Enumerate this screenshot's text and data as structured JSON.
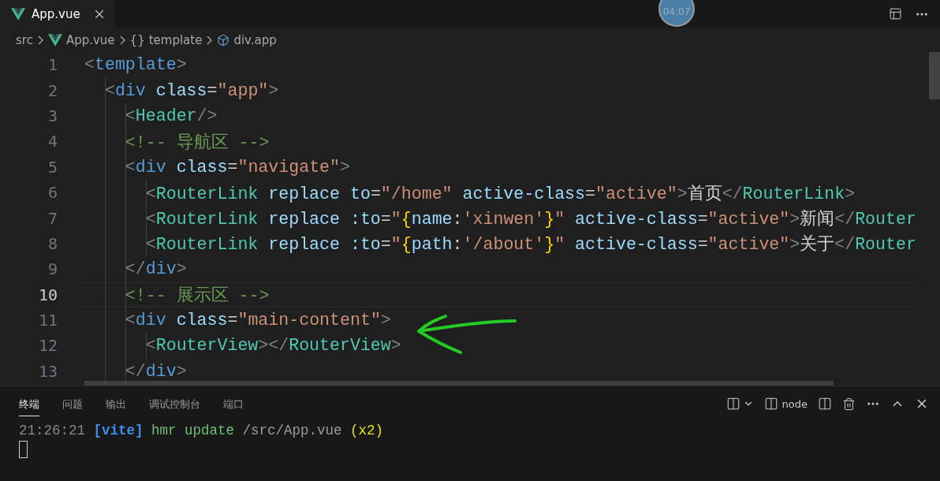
{
  "tabs": [
    {
      "label": "App.vue",
      "selected": true
    }
  ],
  "timer": "04:07",
  "breadcrumb": [
    {
      "kind": "text",
      "label": "src"
    },
    {
      "kind": "vue",
      "label": "App.vue"
    },
    {
      "kind": "braces",
      "icon": "{}",
      "label": "template"
    },
    {
      "kind": "element",
      "label": "div.app"
    }
  ],
  "code_lines": [
    {
      "number": "1",
      "current": false,
      "tokens": [
        {
          "kind": "punct",
          "text": "<"
        },
        {
          "kind": "tag",
          "text": "template"
        },
        {
          "kind": "punct",
          "text": ">"
        }
      ]
    },
    {
      "number": "2",
      "current": false,
      "tokens": [
        {
          "kind": "punct",
          "text": "  <"
        },
        {
          "kind": "tag",
          "text": "div"
        },
        {
          "kind": "attr",
          "text": " class"
        },
        {
          "kind": "plain",
          "text": "="
        },
        {
          "kind": "string",
          "text": "\"app\""
        },
        {
          "kind": "punct",
          "text": ">"
        }
      ]
    },
    {
      "number": "3",
      "current": false,
      "tokens": [
        {
          "kind": "punct",
          "text": "    <"
        },
        {
          "kind": "component",
          "text": "Header"
        },
        {
          "kind": "punct",
          "text": "/>"
        }
      ]
    },
    {
      "number": "4",
      "current": false,
      "tokens": [
        {
          "kind": "comment",
          "text": "    <!-- 导航区 -->"
        }
      ]
    },
    {
      "number": "5",
      "current": false,
      "tokens": [
        {
          "kind": "punct",
          "text": "    <"
        },
        {
          "kind": "tag",
          "text": "div"
        },
        {
          "kind": "attr",
          "text": " class"
        },
        {
          "kind": "plain",
          "text": "="
        },
        {
          "kind": "string",
          "text": "\"navigate\""
        },
        {
          "kind": "punct",
          "text": ">"
        }
      ]
    },
    {
      "number": "6",
      "current": false,
      "tokens": [
        {
          "kind": "punct",
          "text": "      <"
        },
        {
          "kind": "component",
          "text": "RouterLink"
        },
        {
          "kind": "attr",
          "text": " replace"
        },
        {
          "kind": "attr",
          "text": " to"
        },
        {
          "kind": "plain",
          "text": "="
        },
        {
          "kind": "string",
          "text": "\"/home\""
        },
        {
          "kind": "attr",
          "text": " active-class"
        },
        {
          "kind": "plain",
          "text": "="
        },
        {
          "kind": "string",
          "text": "\"active\""
        },
        {
          "kind": "punct",
          "text": ">"
        },
        {
          "kind": "plain",
          "text": "首页"
        },
        {
          "kind": "punct",
          "text": "</"
        },
        {
          "kind": "component",
          "text": "RouterLink"
        },
        {
          "kind": "punct",
          "text": ">"
        }
      ]
    },
    {
      "number": "7",
      "current": false,
      "tokens": [
        {
          "kind": "punct",
          "text": "      <"
        },
        {
          "kind": "component",
          "text": "RouterLink"
        },
        {
          "kind": "attr",
          "text": " replace"
        },
        {
          "kind": "attr",
          "text": " :to"
        },
        {
          "kind": "plain",
          "text": "="
        },
        {
          "kind": "string",
          "text": "\""
        },
        {
          "kind": "brace",
          "text": "{"
        },
        {
          "kind": "attr",
          "text": "name"
        },
        {
          "kind": "plain",
          "text": ":"
        },
        {
          "kind": "string",
          "text": "'xinwen'"
        },
        {
          "kind": "brace",
          "text": "}"
        },
        {
          "kind": "string",
          "text": "\""
        },
        {
          "kind": "attr",
          "text": " active-class"
        },
        {
          "kind": "plain",
          "text": "="
        },
        {
          "kind": "string",
          "text": "\"active\""
        },
        {
          "kind": "punct",
          "text": ">"
        },
        {
          "kind": "plain",
          "text": "新闻"
        },
        {
          "kind": "punct",
          "text": "</"
        },
        {
          "kind": "component",
          "text": "Router"
        }
      ]
    },
    {
      "number": "8",
      "current": false,
      "tokens": [
        {
          "kind": "punct",
          "text": "      <"
        },
        {
          "kind": "component",
          "text": "RouterLink"
        },
        {
          "kind": "attr",
          "text": " replace"
        },
        {
          "kind": "attr",
          "text": " :to"
        },
        {
          "kind": "plain",
          "text": "="
        },
        {
          "kind": "string",
          "text": "\""
        },
        {
          "kind": "brace",
          "text": "{"
        },
        {
          "kind": "attr",
          "text": "path"
        },
        {
          "kind": "plain",
          "text": ":"
        },
        {
          "kind": "string",
          "text": "'/about'"
        },
        {
          "kind": "brace",
          "text": "}"
        },
        {
          "kind": "string",
          "text": "\""
        },
        {
          "kind": "attr",
          "text": " active-class"
        },
        {
          "kind": "plain",
          "text": "="
        },
        {
          "kind": "string",
          "text": "\"active\""
        },
        {
          "kind": "punct",
          "text": ">"
        },
        {
          "kind": "plain",
          "text": "关于"
        },
        {
          "kind": "punct",
          "text": "</"
        },
        {
          "kind": "component",
          "text": "Router"
        }
      ]
    },
    {
      "number": "9",
      "current": false,
      "tokens": [
        {
          "kind": "punct",
          "text": "    </"
        },
        {
          "kind": "tag",
          "text": "div"
        },
        {
          "kind": "punct",
          "text": ">"
        }
      ]
    },
    {
      "number": "10",
      "current": true,
      "tokens": [
        {
          "kind": "comment",
          "text": "    <!-- 展示区 -->"
        }
      ]
    },
    {
      "number": "11",
      "current": false,
      "tokens": [
        {
          "kind": "punct",
          "text": "    <"
        },
        {
          "kind": "tag",
          "text": "div"
        },
        {
          "kind": "attr",
          "text": " class"
        },
        {
          "kind": "plain",
          "text": "="
        },
        {
          "kind": "string",
          "text": "\"main-content\""
        },
        {
          "kind": "punct",
          "text": ">"
        }
      ]
    },
    {
      "number": "12",
      "current": false,
      "tokens": [
        {
          "kind": "punct",
          "text": "      <"
        },
        {
          "kind": "component",
          "text": "RouterView"
        },
        {
          "kind": "punct",
          "text": "></"
        },
        {
          "kind": "component",
          "text": "RouterView"
        },
        {
          "kind": "punct",
          "text": ">"
        }
      ]
    },
    {
      "number": "13",
      "current": false,
      "tokens": [
        {
          "kind": "punct",
          "text": "    </"
        },
        {
          "kind": "tag",
          "text": "div"
        },
        {
          "kind": "punct",
          "text": ">"
        }
      ]
    }
  ],
  "panel_tabs": [
    {
      "label": "终端",
      "selected": true
    },
    {
      "label": "问题",
      "selected": false
    },
    {
      "label": "输出",
      "selected": false
    },
    {
      "label": "调试控制台",
      "selected": false
    },
    {
      "label": "端口",
      "selected": false
    }
  ],
  "terminal_name": "node",
  "terminal_lines": [
    {
      "tokens": [
        {
          "kind": "time",
          "text": "21:26:21"
        },
        {
          "kind": "tag",
          "text": " [vite]"
        },
        {
          "kind": "action",
          "text": " hmr update"
        },
        {
          "kind": "path",
          "text": " /src/App.vue"
        },
        {
          "kind": "count",
          "text": " (x2)"
        }
      ]
    }
  ]
}
